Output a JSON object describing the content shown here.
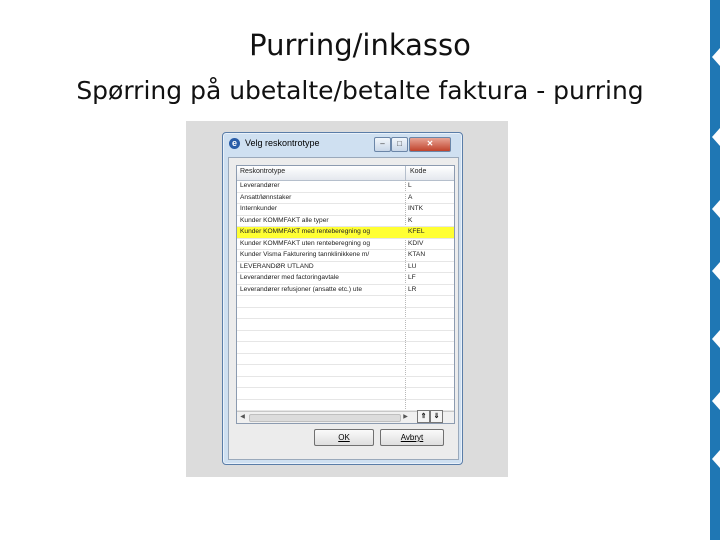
{
  "slide": {
    "title": "Purring/inkasso",
    "subtitle": "Spørring på ubetalte/betalte faktura - purring"
  },
  "dialog": {
    "title": "Velg reskontrotype",
    "app_icon": "e",
    "columns": [
      "Reskontrotype",
      "Kode"
    ],
    "rows": [
      {
        "type": "Leverandører",
        "code": "L",
        "selected": false
      },
      {
        "type": "Ansatt/lønnstaker",
        "code": "A",
        "selected": false
      },
      {
        "type": "Internkunder",
        "code": "INTK",
        "selected": false
      },
      {
        "type": "Kunder KOMMFAKT alle typer",
        "code": "K",
        "selected": false
      },
      {
        "type": "Kunder KOMMFAKT med renteberegning og",
        "code": "KFEL",
        "selected": true
      },
      {
        "type": "Kunder KOMMFAKT uten renteberegning og",
        "code": "KDIV",
        "selected": false
      },
      {
        "type": "Kunder Visma Fakturering tannklinikkene m/",
        "code": "KTAN",
        "selected": false
      },
      {
        "type": "LEVERANDØR UTLAND",
        "code": "LU",
        "selected": false
      },
      {
        "type": "Leverandører med factoringavtale",
        "code": "LF",
        "selected": false
      },
      {
        "type": "Leverandører refusjoner (ansatte etc.) ute",
        "code": "LR",
        "selected": false
      },
      {
        "type": "",
        "code": "",
        "selected": false
      },
      {
        "type": "",
        "code": "",
        "selected": false
      },
      {
        "type": "",
        "code": "",
        "selected": false
      },
      {
        "type": "",
        "code": "",
        "selected": false
      },
      {
        "type": "",
        "code": "",
        "selected": false
      },
      {
        "type": "",
        "code": "",
        "selected": false
      },
      {
        "type": "",
        "code": "",
        "selected": false
      },
      {
        "type": "",
        "code": "",
        "selected": false
      },
      {
        "type": "",
        "code": "",
        "selected": false
      },
      {
        "type": "",
        "code": "",
        "selected": false
      },
      {
        "type": "",
        "code": "",
        "selected": false
      }
    ],
    "nav_up": "⇑",
    "nav_down": "⇓",
    "ok_label": "OK",
    "cancel_label": "Avbryt",
    "min_glyph": "–",
    "max_glyph": "□",
    "close_glyph": "✕"
  },
  "colors": {
    "highlight": "#ffff33",
    "accent_strip": "#1f77b4"
  },
  "icons": [
    "app-icon",
    "minimize-icon",
    "maximize-icon",
    "close-icon",
    "nav-up-icon",
    "nav-down-icon",
    "scroll-left-icon",
    "scroll-right-icon"
  ]
}
